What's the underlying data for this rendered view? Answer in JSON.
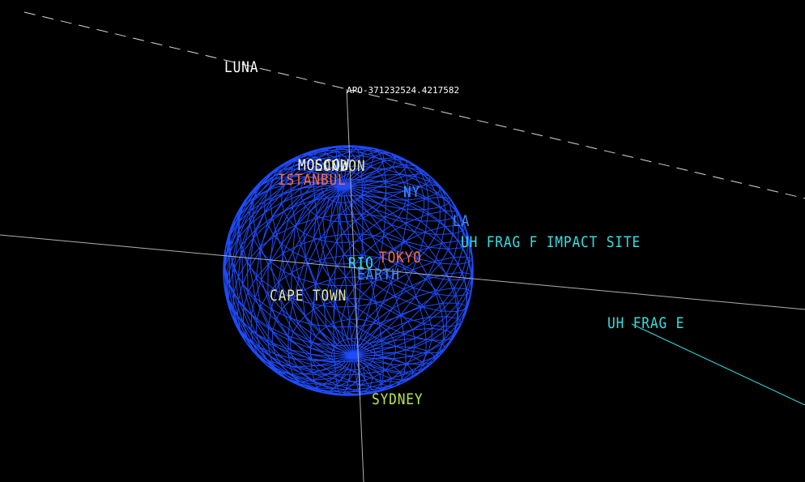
{
  "labels": {
    "luna": "LUNA",
    "apo": "APO-371232524.4217582",
    "moscow": "MOSCOW",
    "london": "LONDON",
    "istanbul": "ISTANBUL",
    "ny": "NY",
    "la": "LA",
    "impact_site": "UH FRAG F IMPACT SITE",
    "tokyo": "TOKYO",
    "rio": "RIO",
    "earth": "EARTH",
    "cape_town": "CAPE TOWN",
    "frag_e": "UH FRAG E",
    "sydney": "SYDNEY"
  },
  "colors": {
    "background": "#000000",
    "globe_wire": "#1f4cff",
    "axis": "#b0b0b0",
    "orbit_dash": "#d8d8d8",
    "white": "#ffffff",
    "yellow": "#e6e6a0",
    "orange": "#ff6a3d",
    "blue_label": "#3f8cff",
    "cyan": "#2fe0e0",
    "green": "#b9e64a"
  }
}
